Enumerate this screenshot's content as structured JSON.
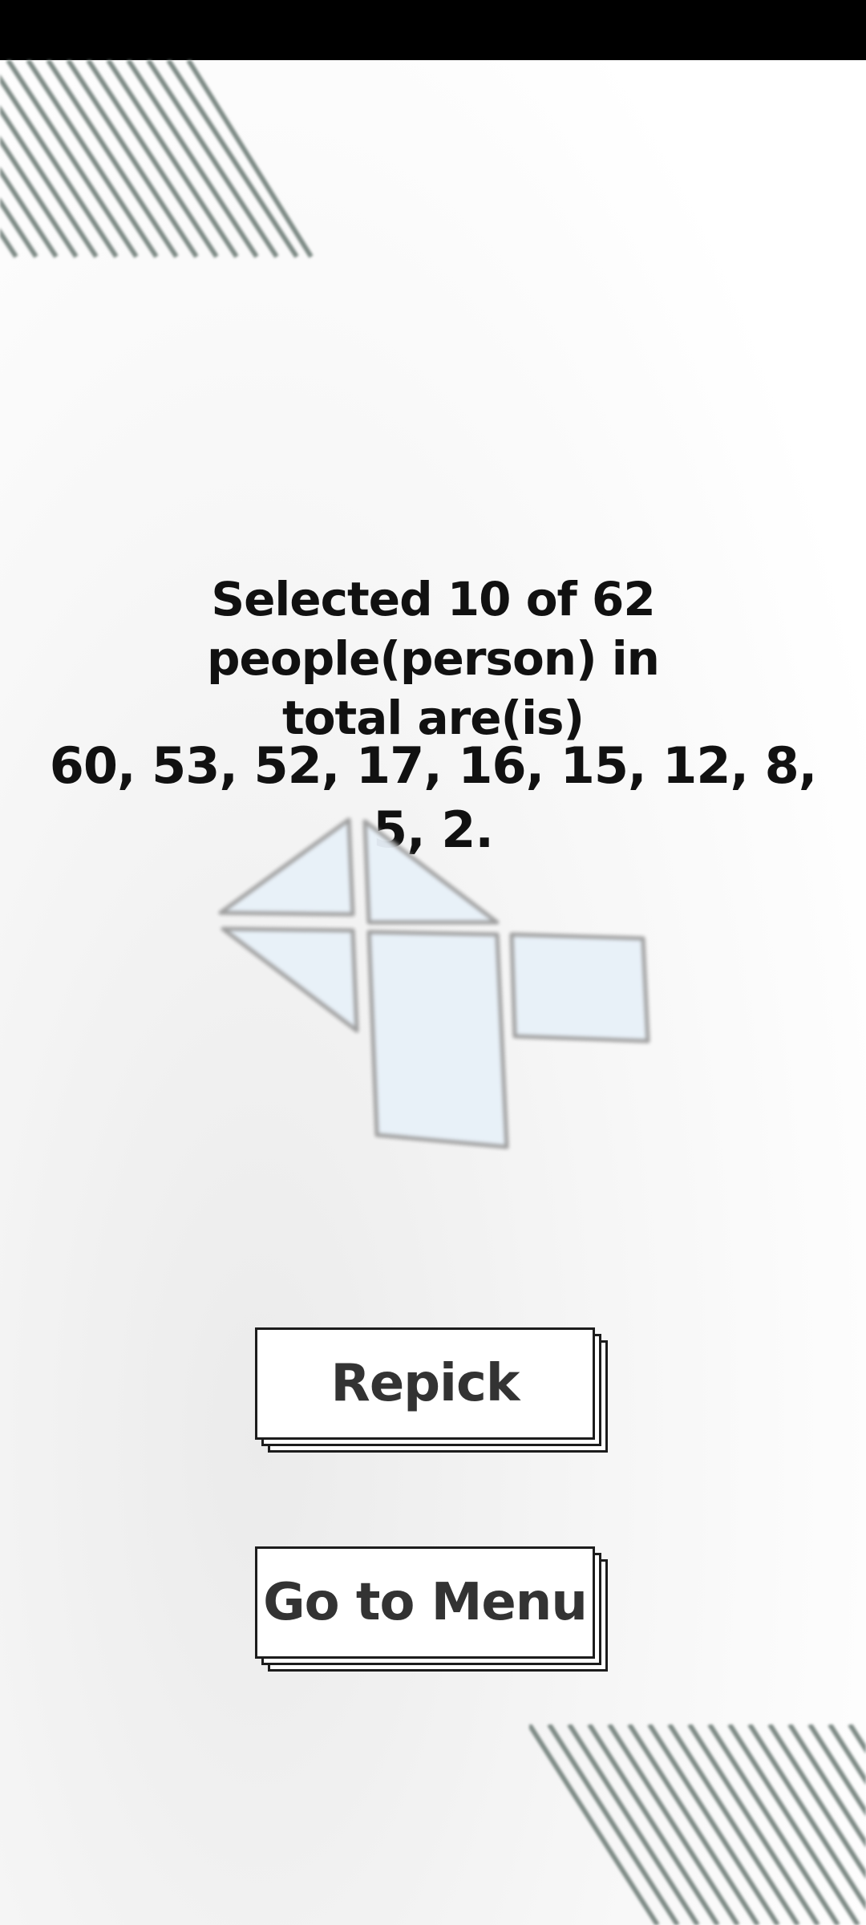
{
  "screen": {
    "title_line1": "Selected 10 of 62 people(person) in",
    "title_line2": "total are(is)",
    "selected_numbers": "60, 53, 52, 17, 16, 15, 12, 8, 5, 2."
  },
  "buttons": {
    "repick_label": "Repick",
    "menu_label": "Go to Menu"
  },
  "colors": {
    "stripe": "#7d8a85",
    "tangram_fill": "#e8f1f9",
    "tangram_stroke": "#9a9a9a",
    "button_border": "#1c1c1c",
    "button_text": "#333333"
  },
  "decorations": {
    "top_left": "diagonal-stripes",
    "center": "tangram-logo",
    "bottom_right": "diagonal-stripes"
  }
}
